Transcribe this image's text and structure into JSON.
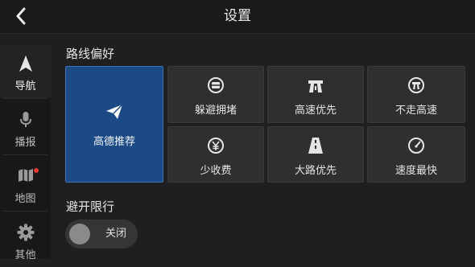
{
  "header": {
    "title": "设置",
    "back_icon": "back-arrow-icon"
  },
  "sidebar": {
    "items": [
      {
        "label": "导航",
        "icon": "navigation-arrow-icon",
        "active": true
      },
      {
        "label": "播报",
        "icon": "microphone-icon",
        "active": false
      },
      {
        "label": "地图",
        "icon": "map-icon",
        "active": false,
        "badge": true
      },
      {
        "label": "其他",
        "icon": "gear-icon",
        "active": false
      }
    ]
  },
  "route_preference": {
    "label": "路线偏好",
    "options": [
      {
        "label": "高德推荐",
        "icon": "paper-plane-icon",
        "selected": true
      },
      {
        "label": "躲避拥堵",
        "icon": "congestion-avoid-icon",
        "selected": false
      },
      {
        "label": "高速优先",
        "icon": "highway-icon",
        "selected": false
      },
      {
        "label": "不走高速",
        "icon": "no-highway-icon",
        "selected": false
      },
      {
        "label": "少收费",
        "icon": "yuan-icon",
        "selected": false
      },
      {
        "label": "大路优先",
        "icon": "main-road-icon",
        "selected": false
      },
      {
        "label": "速度最快",
        "icon": "speedometer-icon",
        "selected": false
      }
    ]
  },
  "restriction": {
    "label": "避开限行",
    "toggle_label": "关闭",
    "on": false
  },
  "colors": {
    "accent_tile": "#1b4a86",
    "badge": "#e53935",
    "background": "#1f1f21"
  }
}
